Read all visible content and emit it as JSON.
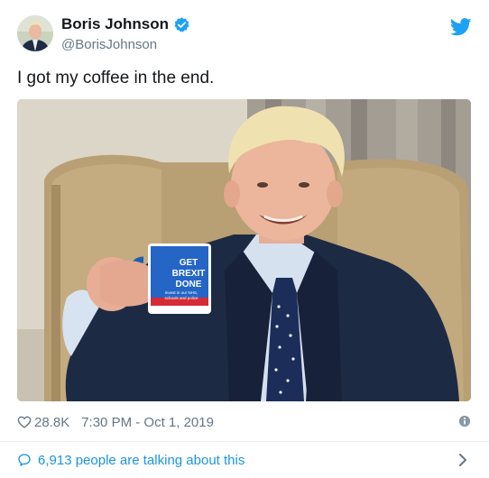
{
  "tweet": {
    "author_name": "Boris Johnson",
    "author_handle": "@BorisJohnson",
    "verified": true,
    "text": "I got my coffee in the end.",
    "photo": {
      "mug_lines": [
        "GET",
        "BREXIT",
        "DONE",
        "invest in our NHS,",
        "schools and police"
      ]
    },
    "likes": "28.8K",
    "timestamp": "7:30 PM - Oct 1, 2019",
    "conversation": "6,913 people are talking about this"
  },
  "colors": {
    "brand_blue": "#1da1f2",
    "link_blue": "#1b95e0",
    "muted_gray": "#657786",
    "text": "#14171a",
    "divider": "#e6ecf0"
  },
  "icons": [
    "verified-badge-icon",
    "twitter-bird-icon",
    "heart-icon",
    "info-icon",
    "chat-bubble-icon",
    "chevron-right-icon"
  ]
}
